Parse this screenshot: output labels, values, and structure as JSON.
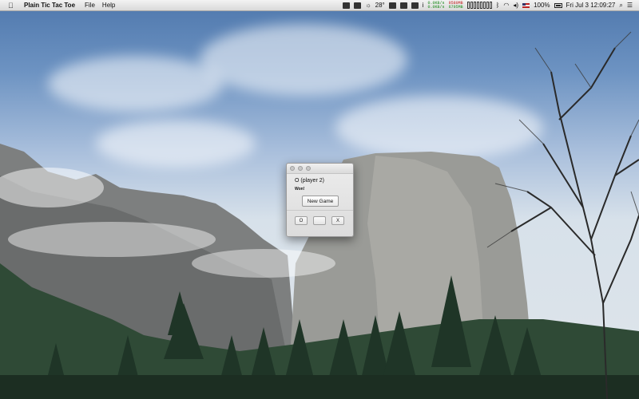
{
  "menubar": {
    "apple": "",
    "app_name": "Plain Tic Tac Toe",
    "menus": [
      "File",
      "Help"
    ],
    "status": {
      "temperature": "28°",
      "net_up": "0.0KB/s",
      "net_down": "0.0KB/s",
      "mem_used": "9580MB",
      "mem_free": "6795MB",
      "battery": "100%",
      "datetime": "Fri Jul 3  12:09:27"
    }
  },
  "window": {
    "status_text": "O  (player 2)",
    "result_text": "Won!",
    "new_game_label": "New Game",
    "board_row": [
      "O",
      "",
      "X"
    ]
  }
}
